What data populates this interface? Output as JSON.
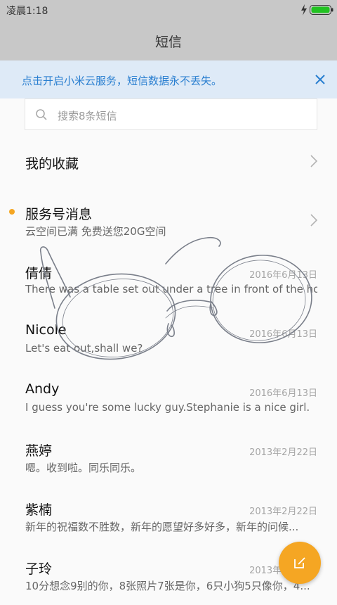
{
  "status": {
    "time": "凌晨1:18"
  },
  "header": {
    "title": "短信"
  },
  "banner": {
    "text": "点击开启小米云服务，短信数据永不丢失。"
  },
  "search": {
    "placeholder": "搜索8条短信"
  },
  "favorites": {
    "label": "我的收藏"
  },
  "service": {
    "name": "服务号消息",
    "preview": "云空间已满 免费送您20G空间"
  },
  "conversations": [
    {
      "name": "倩倩",
      "date": "2016年6月13日",
      "preview": "There was a table set out under a tree in front of the ho..."
    },
    {
      "name": "Nicole",
      "date": "2016年6月13日",
      "preview": "Let's eat out,shall we?"
    },
    {
      "name": "Andy",
      "date": "2016年6月13日",
      "preview": "I guess you're some lucky guy.Stephanie is a nice girl."
    },
    {
      "name": "燕婷",
      "date": "2013年2月22日",
      "preview": "嗯。收到啦。同乐同乐。"
    },
    {
      "name": "紫楠",
      "date": "2013年2月22日",
      "preview": "新年的祝福数不胜数，新年的愿望好多好多，新年的问候..."
    },
    {
      "name": "子玲",
      "date": "2013年2月22日",
      "preview": "10分想念9别的你，8张照片7张是你，6只小狗5只像你，4..."
    }
  ],
  "colors": {
    "accent": "#f5a623",
    "banner_text": "#2a7fd0",
    "bar": "#c8c8c8"
  },
  "icons": [
    "bolt-icon",
    "battery-icon",
    "close-icon",
    "search-icon",
    "chevron-right-icon",
    "compose-icon"
  ]
}
